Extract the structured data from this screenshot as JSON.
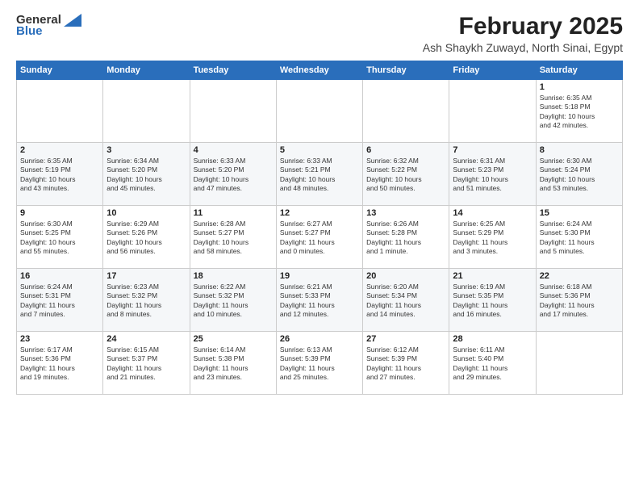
{
  "logo": {
    "general": "General",
    "blue": "Blue"
  },
  "title": "February 2025",
  "subtitle": "Ash Shaykh Zuwayd, North Sinai, Egypt",
  "days_of_week": [
    "Sunday",
    "Monday",
    "Tuesday",
    "Wednesday",
    "Thursday",
    "Friday",
    "Saturday"
  ],
  "weeks": [
    [
      {
        "day": "",
        "info": ""
      },
      {
        "day": "",
        "info": ""
      },
      {
        "day": "",
        "info": ""
      },
      {
        "day": "",
        "info": ""
      },
      {
        "day": "",
        "info": ""
      },
      {
        "day": "",
        "info": ""
      },
      {
        "day": "1",
        "info": "Sunrise: 6:35 AM\nSunset: 5:18 PM\nDaylight: 10 hours\nand 42 minutes."
      }
    ],
    [
      {
        "day": "2",
        "info": "Sunrise: 6:35 AM\nSunset: 5:19 PM\nDaylight: 10 hours\nand 43 minutes."
      },
      {
        "day": "3",
        "info": "Sunrise: 6:34 AM\nSunset: 5:20 PM\nDaylight: 10 hours\nand 45 minutes."
      },
      {
        "day": "4",
        "info": "Sunrise: 6:33 AM\nSunset: 5:20 PM\nDaylight: 10 hours\nand 47 minutes."
      },
      {
        "day": "5",
        "info": "Sunrise: 6:33 AM\nSunset: 5:21 PM\nDaylight: 10 hours\nand 48 minutes."
      },
      {
        "day": "6",
        "info": "Sunrise: 6:32 AM\nSunset: 5:22 PM\nDaylight: 10 hours\nand 50 minutes."
      },
      {
        "day": "7",
        "info": "Sunrise: 6:31 AM\nSunset: 5:23 PM\nDaylight: 10 hours\nand 51 minutes."
      },
      {
        "day": "8",
        "info": "Sunrise: 6:30 AM\nSunset: 5:24 PM\nDaylight: 10 hours\nand 53 minutes."
      }
    ],
    [
      {
        "day": "9",
        "info": "Sunrise: 6:30 AM\nSunset: 5:25 PM\nDaylight: 10 hours\nand 55 minutes."
      },
      {
        "day": "10",
        "info": "Sunrise: 6:29 AM\nSunset: 5:26 PM\nDaylight: 10 hours\nand 56 minutes."
      },
      {
        "day": "11",
        "info": "Sunrise: 6:28 AM\nSunset: 5:27 PM\nDaylight: 10 hours\nand 58 minutes."
      },
      {
        "day": "12",
        "info": "Sunrise: 6:27 AM\nSunset: 5:27 PM\nDaylight: 11 hours\nand 0 minutes."
      },
      {
        "day": "13",
        "info": "Sunrise: 6:26 AM\nSunset: 5:28 PM\nDaylight: 11 hours\nand 1 minute."
      },
      {
        "day": "14",
        "info": "Sunrise: 6:25 AM\nSunset: 5:29 PM\nDaylight: 11 hours\nand 3 minutes."
      },
      {
        "day": "15",
        "info": "Sunrise: 6:24 AM\nSunset: 5:30 PM\nDaylight: 11 hours\nand 5 minutes."
      }
    ],
    [
      {
        "day": "16",
        "info": "Sunrise: 6:24 AM\nSunset: 5:31 PM\nDaylight: 11 hours\nand 7 minutes."
      },
      {
        "day": "17",
        "info": "Sunrise: 6:23 AM\nSunset: 5:32 PM\nDaylight: 11 hours\nand 8 minutes."
      },
      {
        "day": "18",
        "info": "Sunrise: 6:22 AM\nSunset: 5:32 PM\nDaylight: 11 hours\nand 10 minutes."
      },
      {
        "day": "19",
        "info": "Sunrise: 6:21 AM\nSunset: 5:33 PM\nDaylight: 11 hours\nand 12 minutes."
      },
      {
        "day": "20",
        "info": "Sunrise: 6:20 AM\nSunset: 5:34 PM\nDaylight: 11 hours\nand 14 minutes."
      },
      {
        "day": "21",
        "info": "Sunrise: 6:19 AM\nSunset: 5:35 PM\nDaylight: 11 hours\nand 16 minutes."
      },
      {
        "day": "22",
        "info": "Sunrise: 6:18 AM\nSunset: 5:36 PM\nDaylight: 11 hours\nand 17 minutes."
      }
    ],
    [
      {
        "day": "23",
        "info": "Sunrise: 6:17 AM\nSunset: 5:36 PM\nDaylight: 11 hours\nand 19 minutes."
      },
      {
        "day": "24",
        "info": "Sunrise: 6:15 AM\nSunset: 5:37 PM\nDaylight: 11 hours\nand 21 minutes."
      },
      {
        "day": "25",
        "info": "Sunrise: 6:14 AM\nSunset: 5:38 PM\nDaylight: 11 hours\nand 23 minutes."
      },
      {
        "day": "26",
        "info": "Sunrise: 6:13 AM\nSunset: 5:39 PM\nDaylight: 11 hours\nand 25 minutes."
      },
      {
        "day": "27",
        "info": "Sunrise: 6:12 AM\nSunset: 5:39 PM\nDaylight: 11 hours\nand 27 minutes."
      },
      {
        "day": "28",
        "info": "Sunrise: 6:11 AM\nSunset: 5:40 PM\nDaylight: 11 hours\nand 29 minutes."
      },
      {
        "day": "",
        "info": ""
      }
    ]
  ]
}
